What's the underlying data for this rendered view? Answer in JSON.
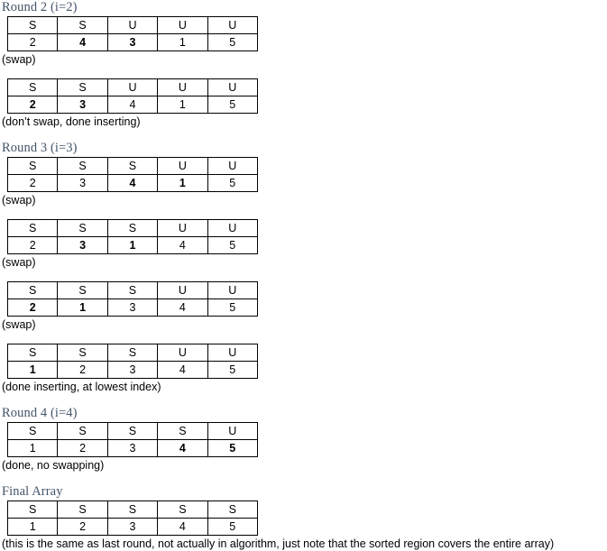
{
  "document": {
    "type": "insertion-sort-trace",
    "accent_heading_color": "#44546A",
    "border_color": "#000000",
    "text_color": "#000000"
  },
  "sections": [
    {
      "heading": "Round 2 (i=2)",
      "steps": [
        {
          "states": [
            "S",
            "S",
            "U",
            "U",
            "U"
          ],
          "values": [
            "2",
            "4",
            "3",
            "1",
            "5"
          ],
          "bold": [
            false,
            true,
            true,
            false,
            false
          ],
          "caption": "(swap)"
        },
        {
          "states": [
            "S",
            "S",
            "U",
            "U",
            "U"
          ],
          "values": [
            "2",
            "3",
            "4",
            "1",
            "5"
          ],
          "bold": [
            true,
            true,
            false,
            false,
            false
          ],
          "caption": "(don’t swap, done inserting)"
        }
      ]
    },
    {
      "heading": "Round 3 (i=3)",
      "steps": [
        {
          "states": [
            "S",
            "S",
            "S",
            "U",
            "U"
          ],
          "values": [
            "2",
            "3",
            "4",
            "1",
            "5"
          ],
          "bold": [
            false,
            false,
            true,
            true,
            false
          ],
          "caption": "(swap)"
        },
        {
          "states": [
            "S",
            "S",
            "S",
            "U",
            "U"
          ],
          "values": [
            "2",
            "3",
            "1",
            "4",
            "5"
          ],
          "bold": [
            false,
            true,
            true,
            false,
            false
          ],
          "caption": "(swap)"
        },
        {
          "states": [
            "S",
            "S",
            "S",
            "U",
            "U"
          ],
          "values": [
            "2",
            "1",
            "3",
            "4",
            "5"
          ],
          "bold": [
            true,
            true,
            false,
            false,
            false
          ],
          "caption": "(swap)"
        },
        {
          "states": [
            "S",
            "S",
            "S",
            "U",
            "U"
          ],
          "values": [
            "1",
            "2",
            "3",
            "4",
            "5"
          ],
          "bold": [
            true,
            false,
            false,
            false,
            false
          ],
          "caption": "(done inserting, at lowest index)"
        }
      ]
    },
    {
      "heading": "Round 4 (i=4)",
      "steps": [
        {
          "states": [
            "S",
            "S",
            "S",
            "S",
            "U"
          ],
          "values": [
            "1",
            "2",
            "3",
            "4",
            "5"
          ],
          "bold": [
            false,
            false,
            false,
            true,
            true
          ],
          "caption": "(done, no swapping)"
        }
      ]
    },
    {
      "heading": "Final Array",
      "steps": [
        {
          "states": [
            "S",
            "S",
            "S",
            "S",
            "S"
          ],
          "values": [
            "1",
            "2",
            "3",
            "4",
            "5"
          ],
          "bold": [
            false,
            false,
            false,
            false,
            false
          ],
          "caption": "(this is the same as last round, not actually in algorithm, just note that the sorted region covers the entire array)"
        }
      ]
    }
  ]
}
